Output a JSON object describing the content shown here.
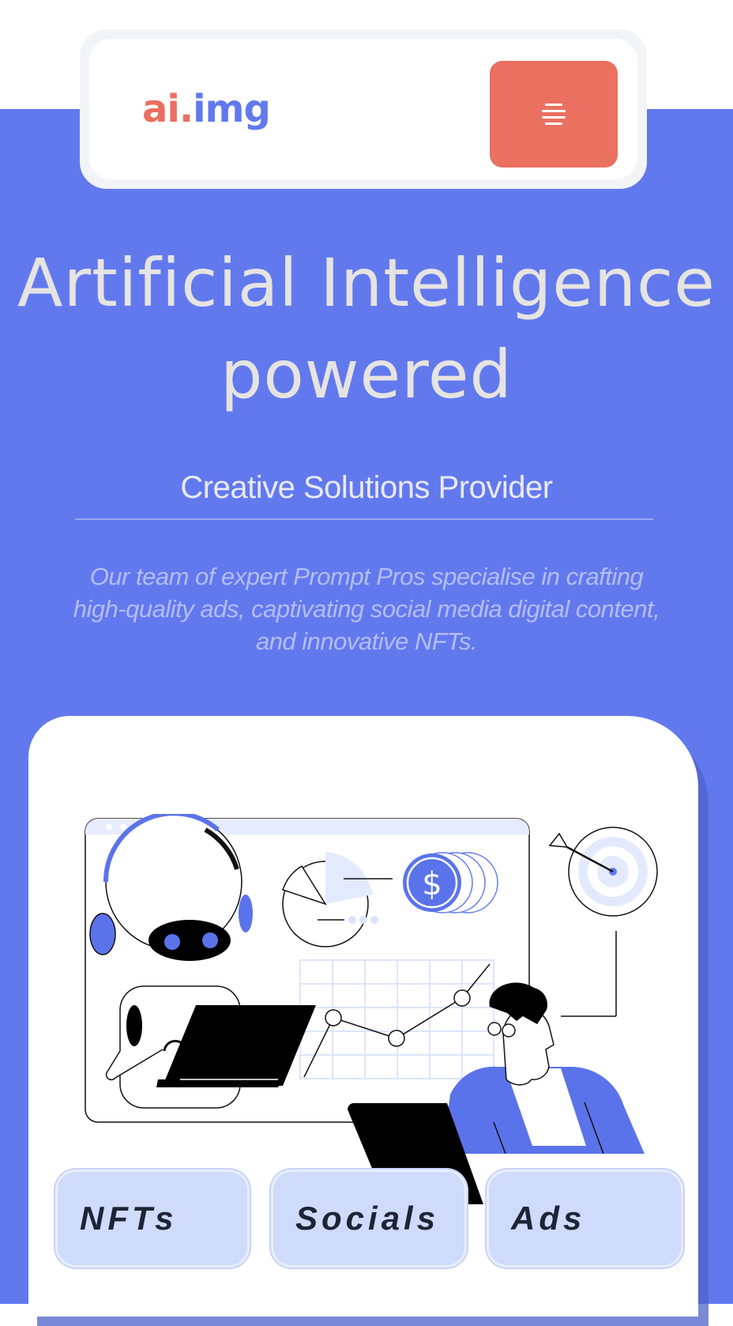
{
  "header": {
    "logo_part1": "ai.",
    "logo_part2": "img",
    "menu_icon": "hamburger-icon"
  },
  "hero": {
    "title_line1": "Artificial Intelligence",
    "title_line2": "powered",
    "subtitle": "Creative Solutions Provider",
    "description_line1": "Our team of expert Prompt Pros specialise in crafting",
    "description_line2": "high-quality ads, captivating social media digital content,",
    "description_line3": "and innovative NFTs."
  },
  "illustration": {
    "dollar_symbol": "$",
    "icons": [
      "robot-icon",
      "laptop-icon",
      "pie-chart-icon",
      "coin-icon",
      "target-icon",
      "line-chart-icon",
      "person-icon"
    ]
  },
  "tags": [
    "NFTs",
    "Socials",
    "Ads"
  ],
  "colors": {
    "brand_blue": "#6279ee",
    "accent_coral": "#ea7060",
    "tag_bg": "#cfdbfa",
    "title_text": "#e6e4e1"
  }
}
